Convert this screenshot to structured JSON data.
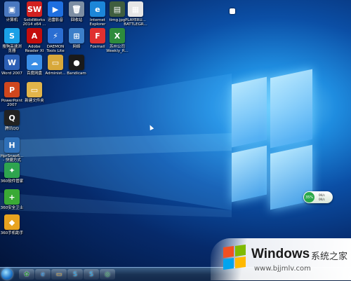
{
  "desktop": {
    "icons": [
      {
        "label": "计算机",
        "color": "#4a78c0",
        "glyph": "▣",
        "icon": "computer-icon"
      },
      {
        "label": "SolidWorks\n2014 x64 ...",
        "color": "#d22020",
        "glyph": "SW",
        "icon": "solidworks-icon"
      },
      {
        "label": "迅雷影音",
        "color": "#1e6fe0",
        "glyph": "▶",
        "icon": "thunder-player-icon"
      },
      {
        "label": "回收站",
        "color": "#7d8ea3",
        "glyph": "🗑",
        "icon": "recycle-bin-icon"
      },
      {
        "label": "Internet\nExplorer",
        "color": "#1c86d8",
        "glyph": "e",
        "icon": "ie-icon"
      },
      {
        "label": "timg.jpg",
        "color": "#3f5d3f",
        "glyph": "▤",
        "icon": "image-file-icon"
      },
      {
        "label": "PLAYERU...\nBATTLEGR...",
        "color": "#e6e6e6",
        "glyph": "▦",
        "icon": "document-icon"
      },
      {
        "label": "搜狗高速浏\n览器",
        "color": "#1aa0e6",
        "glyph": "S",
        "icon": "sogou-browser-icon"
      },
      {
        "label": "Adobe\nReader XI",
        "color": "#c40d0d",
        "glyph": "A",
        "icon": "adobe-reader-icon"
      },
      {
        "label": "DAEMON\nTools Lite",
        "color": "#2b6ed2",
        "glyph": "⚡",
        "icon": "daemon-tools-icon"
      },
      {
        "label": "网络",
        "color": "#3c7fc9",
        "glyph": "⊞",
        "icon": "network-icon"
      },
      {
        "label": "Foxmail",
        "color": "#e03030",
        "glyph": "F",
        "icon": "foxmail-icon"
      },
      {
        "label": "苏州公司\nWeekly_R...",
        "color": "#2e8b3c",
        "glyph": "X",
        "icon": "excel-file-icon"
      },
      {
        "label": "Word 2007",
        "color": "#2b5fb5",
        "glyph": "W",
        "icon": "word-icon"
      },
      {
        "label": "百度网盘",
        "color": "#3a8ee6",
        "glyph": "☁",
        "icon": "baidu-netdisk-icon"
      },
      {
        "label": "Administ...",
        "color": "#d8a83a",
        "glyph": "▭",
        "icon": "folder-icon"
      },
      {
        "label": "Bandicam",
        "color": "#1a1a1a",
        "glyph": "●",
        "icon": "bandicam-icon"
      },
      {
        "label": "PowerPoint\n2007",
        "color": "#d0471e",
        "glyph": "P",
        "icon": "powerpoint-icon"
      },
      {
        "label": "新建文件夹",
        "color": "#e2b54a",
        "glyph": "▭",
        "icon": "new-folder-icon"
      },
      {
        "label": "腾讯QQ",
        "color": "#222222",
        "glyph": "Q",
        "icon": "qq-icon"
      },
      {
        "label": "HprSnap6...\n- 快捷方式",
        "color": "#2f70b8",
        "glyph": "H",
        "icon": "hypersnap-icon"
      },
      {
        "label": "360软件管家",
        "color": "#2ea44f",
        "glyph": "✦",
        "icon": "360-software-icon"
      },
      {
        "label": "360安全卫士",
        "color": "#3aaa35",
        "glyph": "+",
        "icon": "360-security-icon"
      },
      {
        "label": "360手机助手",
        "color": "#e8a320",
        "glyph": "◆",
        "icon": "360-mobile-icon"
      }
    ]
  },
  "gadget": {
    "percent": "35%",
    "row1": "0K/s",
    "row2": "0K/s"
  },
  "taskbar": {
    "items": [
      {
        "icon": "360-browser-icon",
        "glyph": "✿",
        "color": "#2d8f3f"
      },
      {
        "icon": "ie-taskbar-icon",
        "glyph": "e",
        "color": "#1c86d8"
      },
      {
        "icon": "explorer-icon",
        "glyph": "▭",
        "color": "#d8a83a"
      },
      {
        "icon": "sogou-taskbar-icon",
        "glyph": "S",
        "color": "#1aa0e6"
      },
      {
        "icon": "sogou-2-taskbar-icon",
        "glyph": "S",
        "color": "#1aa0e6"
      },
      {
        "icon": "360-taskbar-icon",
        "glyph": "◎",
        "color": "#2ea44f"
      }
    ]
  },
  "watermark": {
    "title": "Windows",
    "subtitle": "系统之家",
    "url": "www.bjjmlv.com"
  }
}
